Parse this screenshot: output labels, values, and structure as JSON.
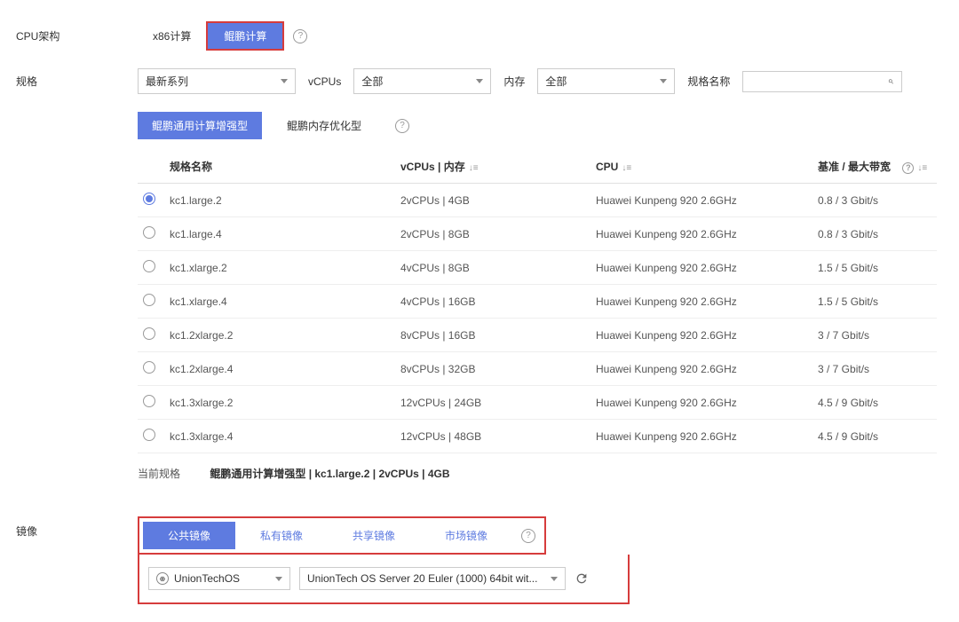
{
  "cpu_arch": {
    "label": "CPU架构",
    "options": [
      "x86计算",
      "鲲鹏计算"
    ],
    "selected_index": 1
  },
  "spec": {
    "label": "规格",
    "series_label": "最新系列",
    "vcpu_label": "vCPUs",
    "vcpu_value": "全部",
    "memory_label": "内存",
    "memory_value": "全部",
    "name_label": "规格名称",
    "search_placeholder": ""
  },
  "categories": {
    "tabs": [
      "鲲鹏通用计算增强型",
      "鲲鹏内存优化型"
    ],
    "active_index": 0
  },
  "table": {
    "headers": {
      "name": "规格名称",
      "vcpus": "vCPUs | 内存",
      "cpu": "CPU",
      "bandwidth": "基准 / 最大带宽"
    },
    "rows": [
      {
        "name": "kc1.large.2",
        "vcpus": "2vCPUs | 4GB",
        "cpu": "Huawei Kunpeng 920 2.6GHz",
        "bandwidth": "0.8 / 3 Gbit/s",
        "selected": true
      },
      {
        "name": "kc1.large.4",
        "vcpus": "2vCPUs | 8GB",
        "cpu": "Huawei Kunpeng 920 2.6GHz",
        "bandwidth": "0.8 / 3 Gbit/s",
        "selected": false
      },
      {
        "name": "kc1.xlarge.2",
        "vcpus": "4vCPUs | 8GB",
        "cpu": "Huawei Kunpeng 920 2.6GHz",
        "bandwidth": "1.5 / 5 Gbit/s",
        "selected": false
      },
      {
        "name": "kc1.xlarge.4",
        "vcpus": "4vCPUs | 16GB",
        "cpu": "Huawei Kunpeng 920 2.6GHz",
        "bandwidth": "1.5 / 5 Gbit/s",
        "selected": false
      },
      {
        "name": "kc1.2xlarge.2",
        "vcpus": "8vCPUs | 16GB",
        "cpu": "Huawei Kunpeng 920 2.6GHz",
        "bandwidth": "3 / 7 Gbit/s",
        "selected": false
      },
      {
        "name": "kc1.2xlarge.4",
        "vcpus": "8vCPUs | 32GB",
        "cpu": "Huawei Kunpeng 920 2.6GHz",
        "bandwidth": "3 / 7 Gbit/s",
        "selected": false
      },
      {
        "name": "kc1.3xlarge.2",
        "vcpus": "12vCPUs | 24GB",
        "cpu": "Huawei Kunpeng 920 2.6GHz",
        "bandwidth": "4.5 / 9 Gbit/s",
        "selected": false
      },
      {
        "name": "kc1.3xlarge.4",
        "vcpus": "12vCPUs | 48GB",
        "cpu": "Huawei Kunpeng 920 2.6GHz",
        "bandwidth": "4.5 / 9 Gbit/s",
        "selected": false
      }
    ]
  },
  "current_spec": {
    "label": "当前规格",
    "value": "鲲鹏通用计算增强型 | kc1.large.2 | 2vCPUs | 4GB"
  },
  "image": {
    "label": "镜像",
    "tabs": [
      "公共镜像",
      "私有镜像",
      "共享镜像",
      "市场镜像"
    ],
    "active_index": 0,
    "os_name": "UnionTechOS",
    "version": "UnionTech OS Server 20 Euler (1000) 64bit wit..."
  }
}
